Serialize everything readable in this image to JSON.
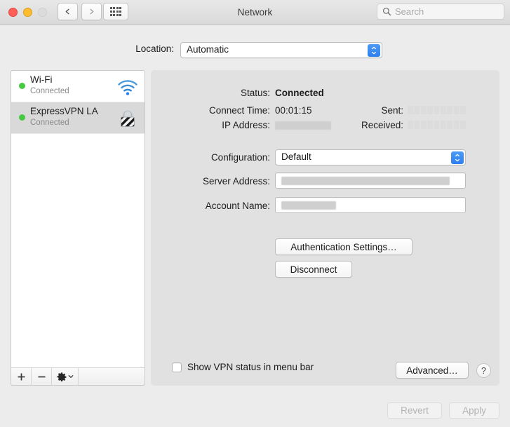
{
  "window": {
    "title": "Network",
    "traffic_lights": [
      "close",
      "minimize",
      "zoom"
    ],
    "nav_back": "back-arrow",
    "nav_forward": "forward-arrow",
    "show_all": "grid-icon"
  },
  "search": {
    "placeholder": "Search",
    "icon": "search-icon",
    "value": ""
  },
  "location": {
    "label": "Location:",
    "value": "Automatic",
    "options": [
      "Automatic"
    ]
  },
  "sidebar": {
    "services": [
      {
        "name": "Wi-Fi",
        "status": "Connected",
        "status_color": "#45c941",
        "icon": "wifi-icon",
        "selected": false
      },
      {
        "name": "ExpressVPN LA",
        "status": "Connected",
        "status_color": "#45c941",
        "icon": "vpn-lock-icon",
        "selected": true
      }
    ],
    "footer": {
      "add": "+",
      "remove": "−",
      "actions_icon": "gear-icon",
      "actions_chevron": "chevron-down-icon"
    }
  },
  "detail": {
    "status_label": "Status:",
    "status_value": "Connected",
    "connect_time_label": "Connect Time:",
    "connect_time_value": "00:01:15",
    "ip_address_label": "IP Address:",
    "ip_address_value": "",
    "sent_label": "Sent:",
    "sent_value": "",
    "received_label": "Received:",
    "received_value": "",
    "configuration_label": "Configuration:",
    "configuration_value": "Default",
    "configuration_options": [
      "Default"
    ],
    "server_address_label": "Server Address:",
    "server_address_value": "",
    "account_name_label": "Account Name:",
    "account_name_value": "",
    "auth_settings_button": "Authentication Settings…",
    "disconnect_button": "Disconnect",
    "show_status_checkbox_label": "Show VPN status in menu bar",
    "show_status_checked": false,
    "advanced_button": "Advanced…",
    "help_button": "?"
  },
  "footer": {
    "revert_button": "Revert",
    "revert_enabled": false,
    "apply_button": "Apply",
    "apply_enabled": false
  },
  "colors": {
    "accent": "#2d7ff0",
    "status_green": "#45c941",
    "window_bg": "#ececec",
    "panel_bg": "#e1e1e1",
    "wifi_blue": "#3d8fd6"
  }
}
